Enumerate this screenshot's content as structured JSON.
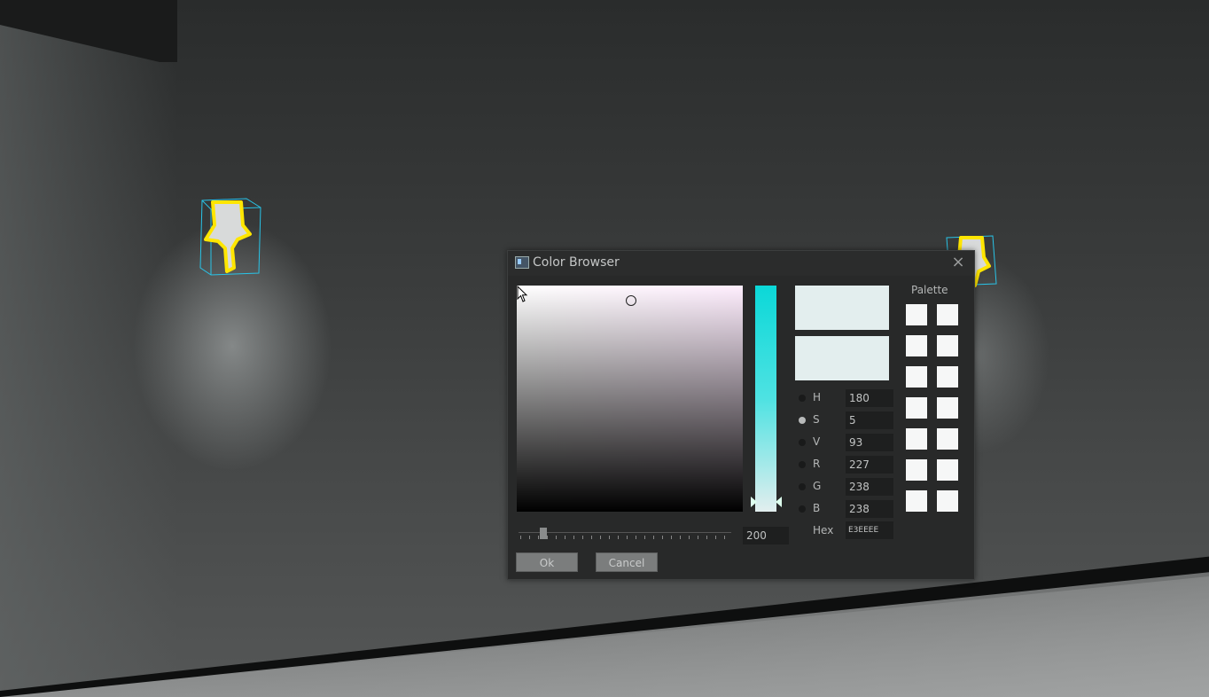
{
  "dialog": {
    "title": "Color Browser",
    "close_glyph": "×",
    "title_icon": "color-browser-icon",
    "close_icon": "close-icon"
  },
  "picker": {
    "current_color": "#E3EEEE",
    "slider_value": "200"
  },
  "params": [
    {
      "key": "H",
      "value": "180",
      "selected": false
    },
    {
      "key": "S",
      "value": "5",
      "selected": true
    },
    {
      "key": "V",
      "value": "93",
      "selected": false
    },
    {
      "key": "R",
      "value": "227",
      "selected": false
    },
    {
      "key": "G",
      "value": "238",
      "selected": false
    },
    {
      "key": "B",
      "value": "238",
      "selected": false
    }
  ],
  "hex": {
    "label": "Hex",
    "value": "E3EEEE"
  },
  "palette": {
    "title": "Palette",
    "swatch_count": 14
  },
  "buttons": {
    "ok": "Ok",
    "cancel": "Cancel"
  }
}
